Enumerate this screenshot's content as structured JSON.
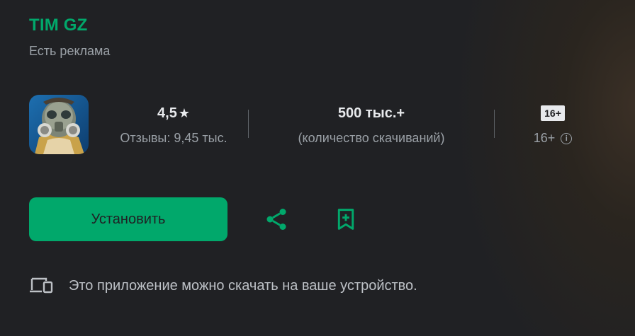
{
  "app": {
    "title": "TIM GZ",
    "ads_note": "Есть реклама"
  },
  "stats": {
    "rating_value": "4,5",
    "rating_star": "★",
    "reviews_label": "Отзывы: 9,45 тыс.",
    "downloads_value": "500 тыс.+",
    "downloads_label": "(количество скачиваний)",
    "age_badge": "16+",
    "age_label": "16+"
  },
  "actions": {
    "install_label": "Установить"
  },
  "device_note": "Это приложение можно скачать на ваше устройство.",
  "colors": {
    "accent": "#01a86b",
    "background": "#202124",
    "text_primary": "#e8eaed",
    "text_secondary": "#9aa0a6"
  },
  "icons": [
    "app-icon",
    "star-icon",
    "info-icon",
    "share-icon",
    "wishlist-add-icon",
    "devices-icon"
  ]
}
